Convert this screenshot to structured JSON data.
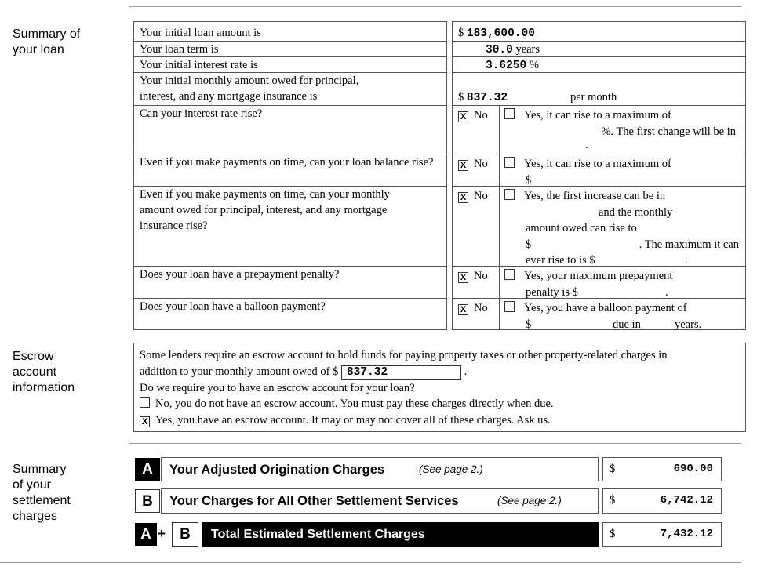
{
  "sections": {
    "loan": "Summary of\nyour loan",
    "escrow": "Escrow\naccount\ninformation",
    "settlement": "Summary\nof your\nsettlement\ncharges"
  },
  "loan": {
    "amount_label": "Your initial loan amount is",
    "amount_currency": "$",
    "amount": "183,600.00",
    "term_label": "Your loan term is",
    "term": "30.0",
    "term_unit": "years",
    "rate_label": "Your initial interest rate is",
    "rate": "3.6250",
    "rate_unit": "%",
    "monthly_label_1": "Your initial monthly amount owed for principal,",
    "monthly_label_2": "interest, and any mortgage insurance is",
    "monthly_currency": "$",
    "monthly": "837.32",
    "monthly_unit": "per month",
    "questions": [
      {
        "q": "Can your interest rate rise?",
        "no_checked": true,
        "yes_checked": false,
        "no": "No",
        "yes_lines": [
          "Yes, it can rise to a maximum of",
          "%. The first change will be in",
          "."
        ]
      },
      {
        "q": "Even if you make payments on time, can your loan balance rise?",
        "no_checked": true,
        "yes_checked": false,
        "no": "No",
        "yes_lines": [
          "Yes, it can rise to a maximum of",
          "$"
        ]
      },
      {
        "q": "Even if you make payments on time, can your monthly amount owed for principal, interest, and any mortgage insurance rise?",
        "no_checked": true,
        "yes_checked": false,
        "no": "No",
        "yes_lines": [
          "Yes, the first increase can be in",
          "and the monthly",
          "amount owed can rise to",
          "$",
          ". The maximum it can",
          "ever rise to is $",
          "."
        ]
      },
      {
        "q": "Does your loan have a prepayment penalty?",
        "no_checked": true,
        "yes_checked": false,
        "no": "No",
        "yes_lines": [
          "Yes, your maximum prepayment",
          "penalty is $",
          "."
        ]
      },
      {
        "q": "Does your loan have a balloon payment?",
        "no_checked": true,
        "yes_checked": false,
        "no": "No",
        "yes_lines": [
          "Yes, you have a balloon payment of",
          "$",
          "due in",
          "years."
        ]
      }
    ]
  },
  "escrow": {
    "line1": "Some lenders require an escrow account to hold funds for paying property taxes or other property-related charges in",
    "line2": "addition to your monthly amount owed of $",
    "amount": "837.32",
    "line2_end": ".",
    "question": "Do we require you to have an escrow account for your loan?",
    "opt_no": "No, you do not have an escrow account. You must pay these charges directly when due.",
    "opt_no_checked": false,
    "opt_yes": "Yes, you have an escrow account. It may or may not cover all of these charges. Ask us.",
    "opt_yes_checked": true,
    "check_mark": "X"
  },
  "charges": {
    "a_letter": "A",
    "a_title": "Your Adjusted Origination Charges",
    "a_see": "(See page 2.)",
    "a_currency": "$",
    "a_amount": "690.00",
    "b_letter": "B",
    "b_title": "Your Charges for All Other Settlement Services",
    "b_see": "(See page 2.)",
    "b_currency": "$",
    "b_amount": "6,742.12",
    "plus": "+",
    "total_title": "Total Estimated Settlement Charges",
    "total_currency": "$",
    "total_amount": "7,432.12"
  }
}
